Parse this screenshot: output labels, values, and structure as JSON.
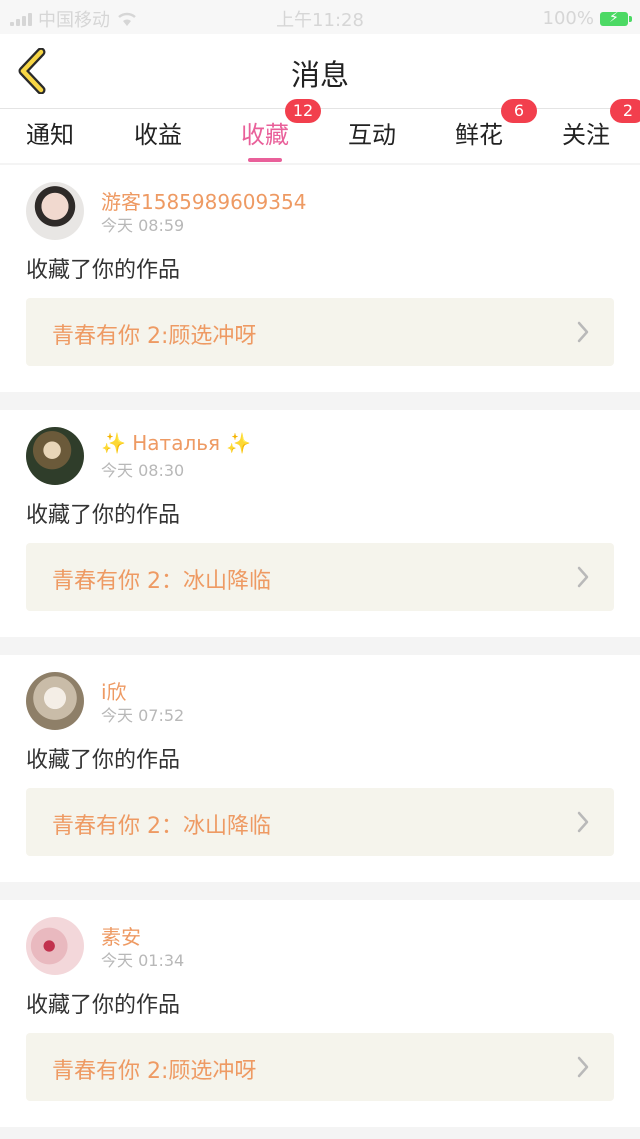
{
  "status_bar": {
    "carrier": "中国移动",
    "time": "上午11:28",
    "battery": "100%"
  },
  "header": {
    "back_icon": "chevron-left-icon",
    "title": "消息",
    "accent_color": "#e9609a"
  },
  "tabs": [
    {
      "label": "通知",
      "badge": ""
    },
    {
      "label": "收益",
      "badge": ""
    },
    {
      "label": "收藏",
      "badge": "12",
      "active": true
    },
    {
      "label": "互动",
      "badge": ""
    },
    {
      "label": "鲜花",
      "badge": "6"
    },
    {
      "label": "关注",
      "badge": "2"
    }
  ],
  "messages": [
    {
      "user": "游客1585989609354",
      "time": "今天 08:59",
      "action": "收藏了你的作品",
      "work": "青春有你 2:顾选冲呀"
    },
    {
      "user": "✨ Наталья ✨",
      "time": "今天 08:30",
      "action": "收藏了你的作品",
      "work": "青春有你 2：冰山降临"
    },
    {
      "user": "i欣",
      "time": "今天 07:52",
      "action": "收藏了你的作品",
      "work": "青春有你 2：冰山降临"
    },
    {
      "user": "素安",
      "time": "今天 01:34",
      "action": "收藏了你的作品",
      "work": "青春有你 2:顾选冲呀"
    }
  ]
}
